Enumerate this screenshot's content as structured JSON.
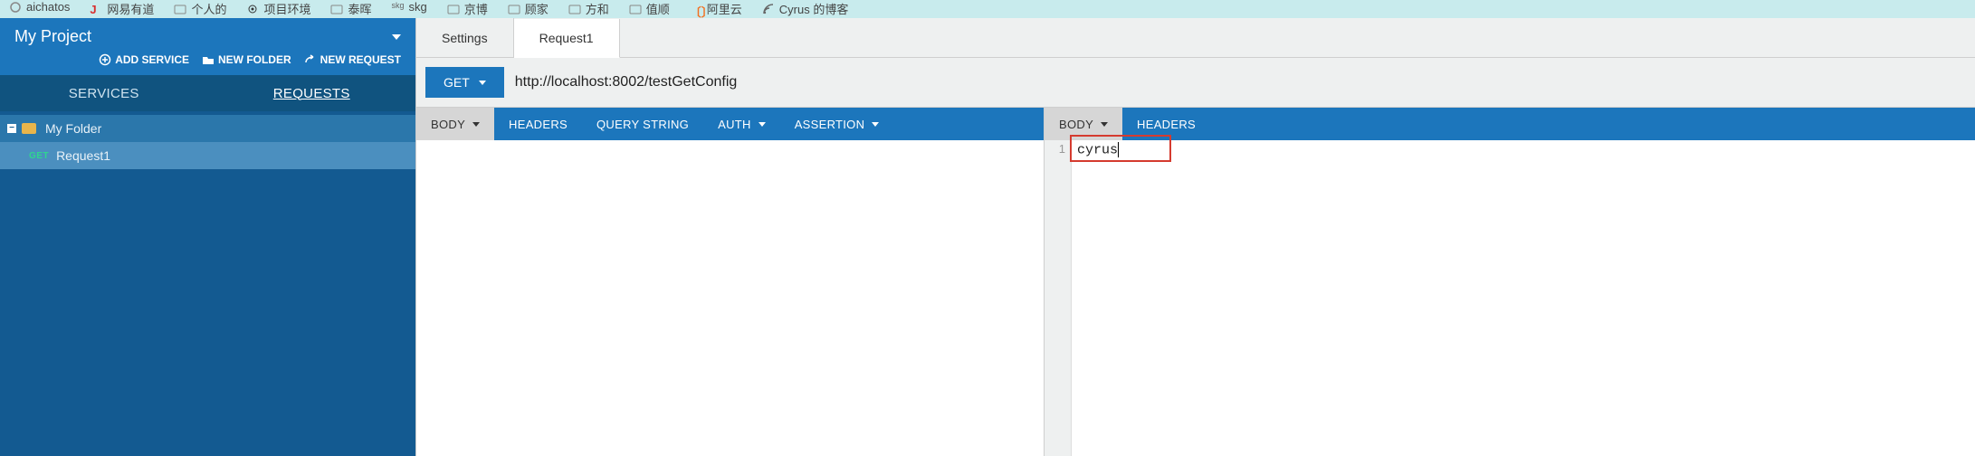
{
  "bookmarks": [
    {
      "icon": "grid",
      "label": "aichatos"
    },
    {
      "icon": "netease",
      "label": "网易有道"
    },
    {
      "icon": "square",
      "label": "个人的"
    },
    {
      "icon": "gear",
      "label": "项目环境"
    },
    {
      "icon": "square",
      "label": "泰晖"
    },
    {
      "icon": "text",
      "label": "skg"
    },
    {
      "icon": "square",
      "label": "京博"
    },
    {
      "icon": "square",
      "label": "顾家"
    },
    {
      "icon": "square",
      "label": "方和"
    },
    {
      "icon": "square",
      "label": "值顺"
    },
    {
      "icon": "aliyun",
      "label": "阿里云"
    },
    {
      "icon": "rss",
      "label": "Cyrus 的博客"
    }
  ],
  "sidebar": {
    "project_title": "My Project",
    "actions": {
      "add_service": "ADD SERVICE",
      "new_folder": "NEW FOLDER",
      "new_request": "NEW REQUEST"
    },
    "tabs": {
      "services": "SERVICES",
      "requests": "REQUESTS",
      "active": "requests"
    },
    "tree": {
      "folder_label": "My Folder",
      "request_method": "GET",
      "request_label": "Request1"
    }
  },
  "main": {
    "tabs": [
      {
        "label": "Settings",
        "active": false
      },
      {
        "label": "Request1",
        "active": true
      }
    ],
    "method": "GET",
    "url": "http://localhost:8002/testGetConfig",
    "request_panel_tabs": [
      {
        "label": "BODY",
        "caret": true,
        "grey": true
      },
      {
        "label": "HEADERS"
      },
      {
        "label": "QUERY STRING"
      },
      {
        "label": "AUTH",
        "caret": true
      },
      {
        "label": "ASSERTION",
        "caret": true
      }
    ],
    "response_panel_tabs": [
      {
        "label": "BODY",
        "caret": true,
        "grey": true
      },
      {
        "label": "HEADERS"
      }
    ],
    "response_line_no": "1",
    "response_text": "cyrus"
  }
}
